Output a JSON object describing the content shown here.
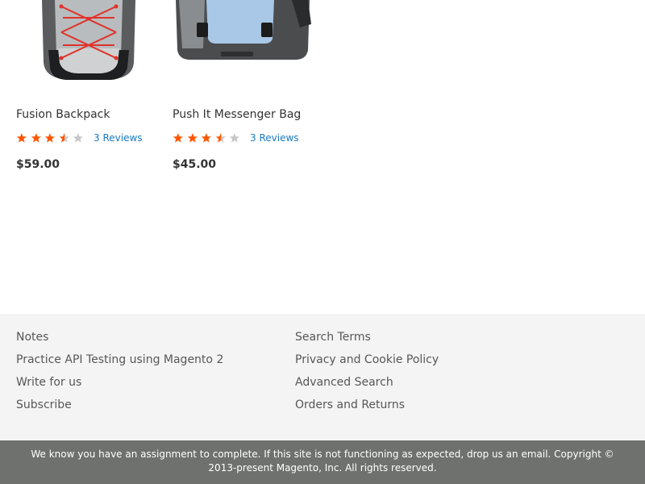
{
  "products": [
    {
      "name": "Fusion Backpack",
      "rating_fraction": 0.7,
      "reviews": "3 Reviews",
      "price": "$59.00",
      "image_icon": "backpack-icon"
    },
    {
      "name": "Push It Messenger Bag",
      "rating_fraction": 0.7,
      "reviews": "3 Reviews",
      "price": "$45.00",
      "image_icon": "messenger-bag-icon"
    }
  ],
  "footer": {
    "col1": [
      "Notes",
      "Practice API Testing using Magento 2",
      "Write for us",
      "Subscribe"
    ],
    "col2": [
      "Search Terms",
      "Privacy and Cookie Policy",
      "Advanced Search",
      "Orders and Returns"
    ]
  },
  "copyright": "We know you have an assignment to complete. If this site is not functioning as expected, drop us an email. Copyright © 2013-present Magento, Inc. All rights reserved.",
  "colors": {
    "star_filled": "#ff5501",
    "star_empty": "#c7c7c7",
    "link_blue": "#1979c3",
    "footer_bg": "#f4f4f4",
    "copyright_bg": "#6e716e"
  }
}
